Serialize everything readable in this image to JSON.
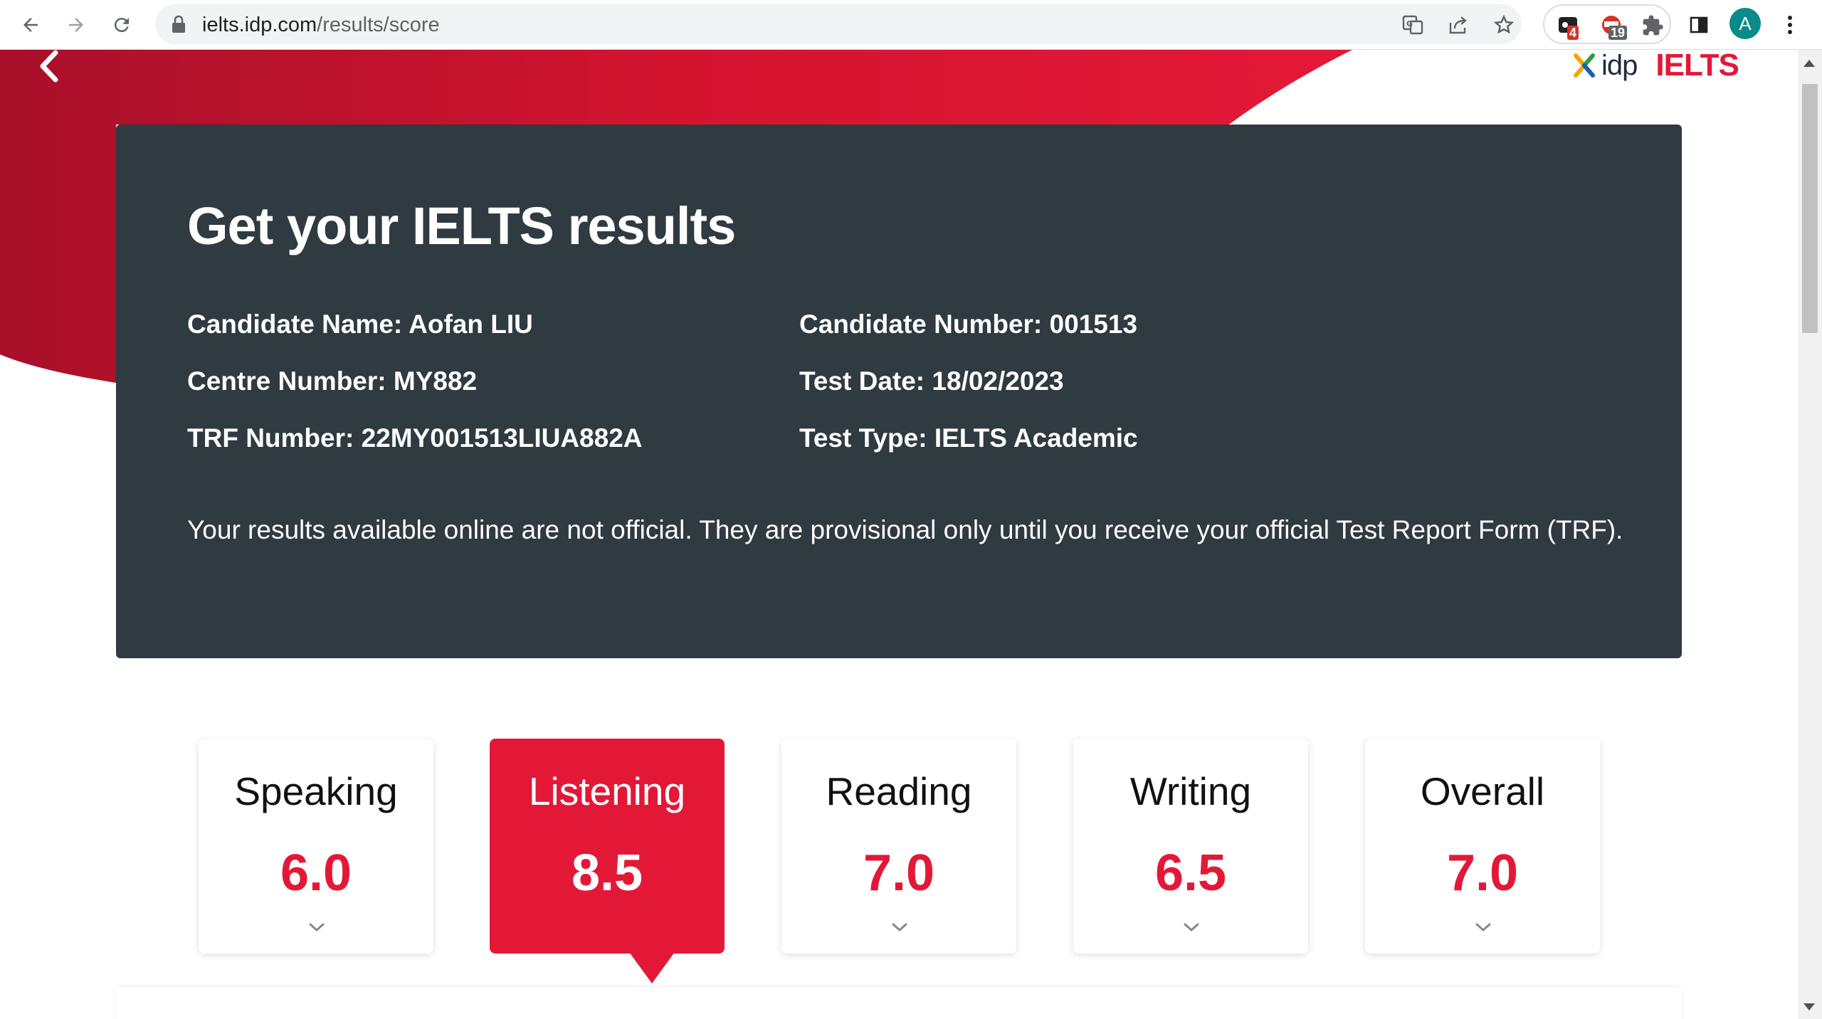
{
  "browser": {
    "url_host": "ielts.idp.com",
    "url_path": "/results/score",
    "extensions": [
      {
        "name": "extension-1",
        "badge": "4"
      },
      {
        "name": "extension-2",
        "badge": "19"
      }
    ],
    "profile_initial": "A"
  },
  "brand": {
    "idp": "idp",
    "ielts": "IELTS"
  },
  "results": {
    "title": "Get your IELTS results",
    "candidate_name": "Candidate Name: Aofan LIU",
    "centre_number": "Centre Number: MY882",
    "trf_number": "TRF Number: 22MY001513LIUA882A",
    "candidate_number": "Candidate Number: 001513",
    "test_date": "Test Date: 18/02/2023",
    "test_type": "Test Type: IELTS Academic",
    "disclaimer": "Your results available online are not official. They are provisional only until you receive your official Test Report Form (TRF)."
  },
  "scores": [
    {
      "label": "Speaking",
      "value": "6.0",
      "selected": false
    },
    {
      "label": "Listening",
      "value": "8.5",
      "selected": true
    },
    {
      "label": "Reading",
      "value": "7.0",
      "selected": false
    },
    {
      "label": "Writing",
      "value": "6.5",
      "selected": false
    },
    {
      "label": "Overall",
      "value": "7.0",
      "selected": false
    }
  ],
  "colors": {
    "brand_red": "#e31837",
    "card_dark": "#2f3a41"
  }
}
